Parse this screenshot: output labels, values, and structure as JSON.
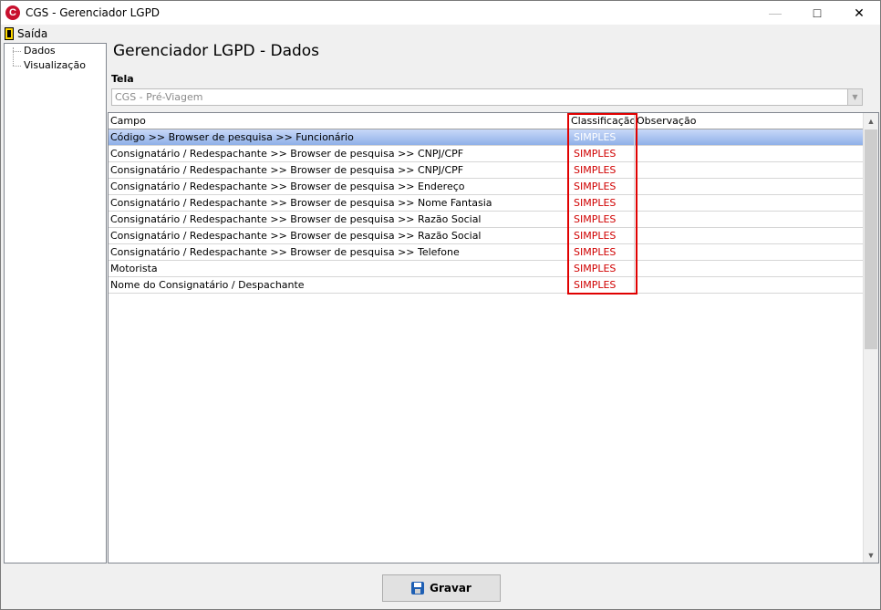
{
  "window": {
    "title": "CGS - Gerenciador LGPD",
    "app_icon": "C"
  },
  "menu": {
    "exit_label": "Saída"
  },
  "tree": {
    "items": [
      "Dados",
      "Visualização"
    ]
  },
  "page_title": "Gerenciador LGPD - Dados",
  "tela": {
    "label": "Tela",
    "value": "CGS - Pré-Viagem"
  },
  "grid": {
    "columns": [
      "Campo",
      "Classificação",
      "Observação"
    ],
    "rows": [
      {
        "campo": "Código >> Browser de pesquisa >> Funcionário",
        "classificacao": "SIMPLES",
        "observacao": ""
      },
      {
        "campo": "Consignatário / Redespachante >> Browser de pesquisa >> CNPJ/CPF",
        "classificacao": "SIMPLES",
        "observacao": ""
      },
      {
        "campo": "Consignatário / Redespachante >> Browser de pesquisa >> CNPJ/CPF",
        "classificacao": "SIMPLES",
        "observacao": ""
      },
      {
        "campo": "Consignatário / Redespachante >> Browser de pesquisa >> Endereço",
        "classificacao": "SIMPLES",
        "observacao": ""
      },
      {
        "campo": "Consignatário / Redespachante >> Browser de pesquisa >> Nome Fantasia",
        "classificacao": "SIMPLES",
        "observacao": ""
      },
      {
        "campo": "Consignatário / Redespachante >> Browser de pesquisa >> Razão Social",
        "classificacao": "SIMPLES",
        "observacao": ""
      },
      {
        "campo": "Consignatário / Redespachante >> Browser de pesquisa >> Razão Social",
        "classificacao": "SIMPLES",
        "observacao": ""
      },
      {
        "campo": "Consignatário / Redespachante >> Browser de pesquisa >> Telefone",
        "classificacao": "SIMPLES",
        "observacao": ""
      },
      {
        "campo": "Motorista",
        "classificacao": "SIMPLES",
        "observacao": ""
      },
      {
        "campo": "Nome do Consignatário / Despachante",
        "classificacao": "SIMPLES",
        "observacao": ""
      }
    ]
  },
  "buttons": {
    "save_label": "Gravar"
  },
  "colors": {
    "classification": "#d00000",
    "highlight_border": "#e00000",
    "selected_row": "#8fb0e8"
  }
}
